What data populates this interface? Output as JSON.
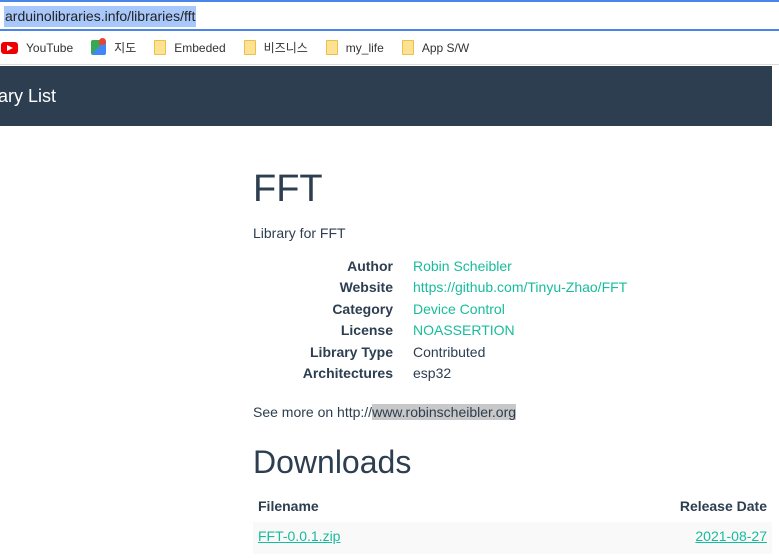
{
  "browser": {
    "url": "arduinolibraries.info/libraries/fft",
    "bookmarks": [
      {
        "label": "YouTube",
        "icon": "youtube-icon"
      },
      {
        "label": "지도",
        "icon": "maps-icon"
      },
      {
        "label": "Embeded",
        "icon": "folder-icon"
      },
      {
        "label": "비즈니스",
        "icon": "folder-icon"
      },
      {
        "label": "my_life",
        "icon": "folder-icon"
      },
      {
        "label": "App S/W",
        "icon": "folder-icon"
      }
    ]
  },
  "navbar": {
    "brand": "rary List"
  },
  "library": {
    "title": "FFT",
    "description": "Library for FFT",
    "meta": [
      {
        "key": "Author",
        "value": "Robin Scheibler",
        "link": true
      },
      {
        "key": "Website",
        "value": "https://github.com/Tinyu-Zhao/FFT",
        "link": true
      },
      {
        "key": "Category",
        "value": "Device Control",
        "link": true
      },
      {
        "key": "License",
        "value": "NOASSERTION",
        "link": true
      },
      {
        "key": "Library Type",
        "value": "Contributed",
        "link": false
      },
      {
        "key": "Architectures",
        "value": "esp32",
        "link": false
      }
    ],
    "see_more_prefix": "See more on http://",
    "see_more_link": "www.robinscheibler.org"
  },
  "downloads": {
    "title": "Downloads",
    "columns": [
      "Filename",
      "Release Date"
    ],
    "rows": [
      {
        "filename": "FFT-0.0.1.zip",
        "date": "2021-08-27"
      }
    ]
  }
}
